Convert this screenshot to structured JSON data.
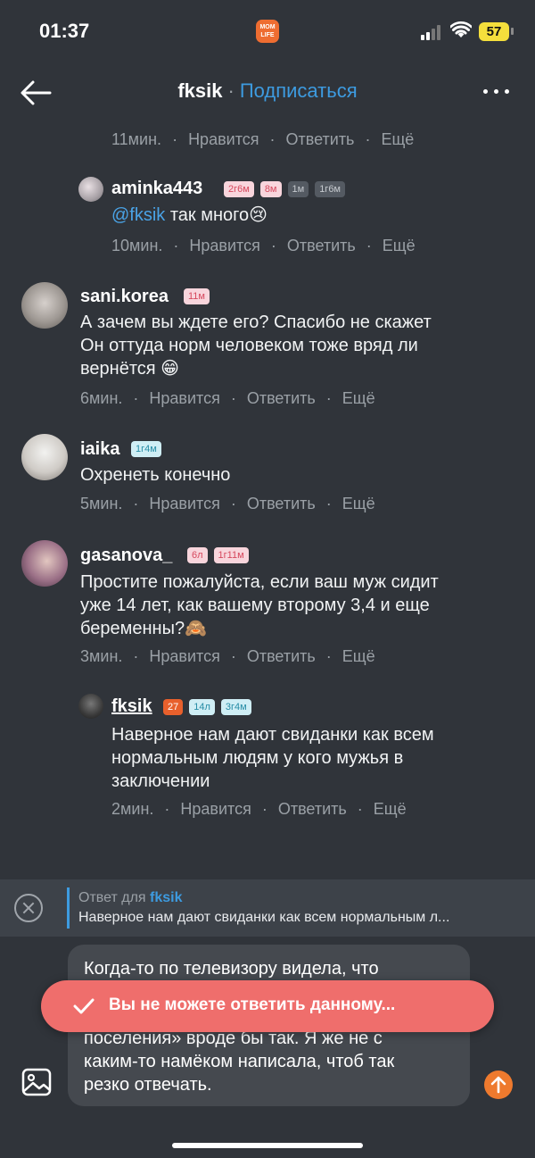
{
  "status_bar": {
    "time": "01:37",
    "app_logo_text": "MOM LIFE",
    "battery": "57"
  },
  "header": {
    "title": "fksik",
    "separator": "·",
    "subscribe": "Подписаться"
  },
  "comments": [
    {
      "id": "c0",
      "partial": true,
      "time": "11мин.",
      "like": "Нравится",
      "reply": "Ответить",
      "more": "Ещё"
    },
    {
      "id": "c1",
      "username": "aminka443",
      "nested": true,
      "badges": [
        "2г6м",
        "8м",
        "1м",
        "1г6м"
      ],
      "mention": "@fksik",
      "lines": [
        "так много😢"
      ],
      "time": "10мин.",
      "like": "Нравится",
      "reply": "Ответить",
      "more": "Ещё"
    },
    {
      "id": "c2",
      "username": "sani.korea",
      "badges": [
        "11м"
      ],
      "lines": [
        "А зачем вы ждете его? Спасибо не скажет",
        "Он оттуда норм человеком тоже вряд ли",
        "вернётся 😁"
      ],
      "time": "6мин.",
      "like": "Нравится",
      "reply": "Ответить",
      "more": "Ещё"
    },
    {
      "id": "c3",
      "username": "iaika",
      "badges": [
        "1г4м"
      ],
      "lines": [
        "Охренеть конечно"
      ],
      "time": "5мин.",
      "like": "Нравится",
      "reply": "Ответить",
      "more": "Ещё"
    },
    {
      "id": "c4",
      "username": "gasanova_",
      "badges": [
        "6л",
        "1г11м"
      ],
      "lines": [
        "Простите пожалуйста, если ваш муж сидит",
        "уже 14 лет, как вашему второму 3,4 и еще",
        "беременны?🙈"
      ],
      "time": "3мин.",
      "like": "Нравится",
      "reply": "Ответить",
      "more": "Ещё"
    },
    {
      "id": "c5",
      "username": "fksik",
      "nested": true,
      "badges": [
        "27",
        "14л",
        "3г4м"
      ],
      "lines": [
        "Наверное нам дают свиданки как всем",
        "нормальным людям у кого мужья в",
        "заключении"
      ],
      "time": "2мин.",
      "like": "Нравится",
      "reply": "Ответить",
      "more": "Ещё"
    }
  ],
  "reply_bar": {
    "prefix": "Ответ для",
    "target": "fksik",
    "snippet": "Наверное нам дают свиданки как всем нормальным л..."
  },
  "composer": {
    "text_lines": [
      "Когда-то по телевизору видела, что",
      "",
      "",
      "поселения» вроде бы так. Я же не с",
      "каким-то намёком написала, чтоб так",
      "резко отвечать."
    ]
  },
  "toast": {
    "message": "Вы не можете ответить данному..."
  },
  "colors": {
    "background": "#30343a",
    "accent_blue": "#3d9be0",
    "toast_red": "#ef6e6c",
    "send_orange": "#ee7a2e"
  }
}
